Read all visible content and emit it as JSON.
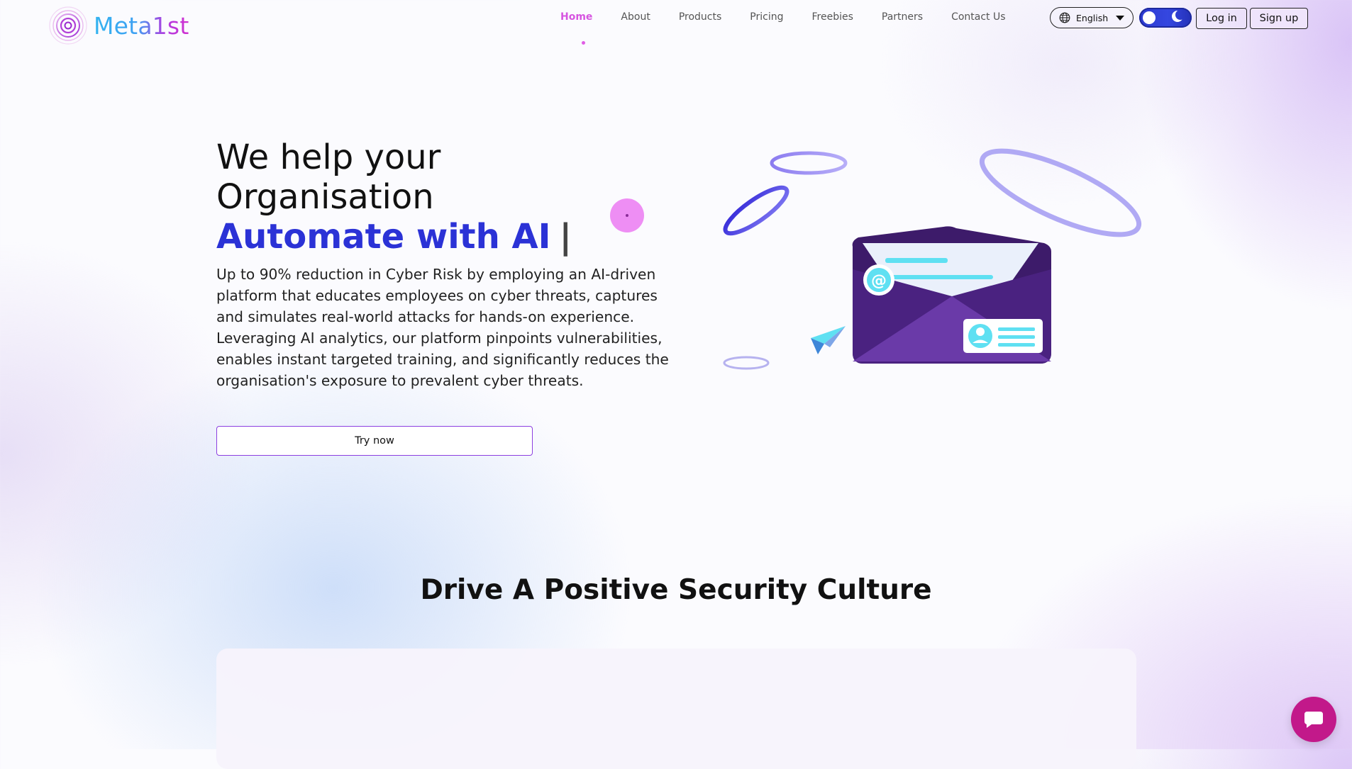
{
  "brand": {
    "logo_text": "Meta1st",
    "colors": {
      "accent_pink": "#d655e0",
      "accent_blue": "#2b32d6",
      "purple": "#8c3fe0",
      "chat": "#c2198a"
    }
  },
  "nav": {
    "items": [
      {
        "label": "Home",
        "active": true
      },
      {
        "label": "About"
      },
      {
        "label": "Products"
      },
      {
        "label": "Pricing"
      },
      {
        "label": "Freebies"
      },
      {
        "label": "Partners"
      },
      {
        "label": "Contact Us"
      }
    ]
  },
  "header": {
    "language": {
      "selected": "English",
      "icon": "globe-icon"
    },
    "theme_toggle": {
      "state": "dark",
      "icon": "moon-icon"
    },
    "login_label": "Log in",
    "signup_label": "Sign up"
  },
  "hero": {
    "title_line1": "We help your",
    "title_line2": "Organisation",
    "accent": "Automate with AI",
    "cursor": "|",
    "description": "Up to 90% reduction in Cyber Risk by employing an AI-driven platform that educates employees on cyber threats, captures and simulates real-world attacks for hands-on experience. Leveraging AI analytics, our platform pinpoints vulnerabilities, enables instant targeted training, and significantly reduces the organisation's exposure to prevalent cyber threats.",
    "cta_label": "Try now",
    "illustration": "envelope-email-illustration"
  },
  "section": {
    "title": "Drive A Positive Security Culture"
  },
  "chat": {
    "icon": "chat-bubble-icon"
  }
}
